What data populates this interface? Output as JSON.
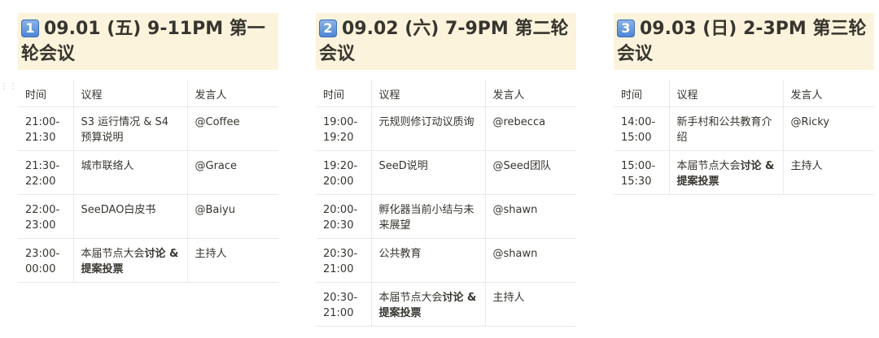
{
  "columns": [
    {
      "keycap": "1",
      "title": "09.01 (五) 9-11PM 第一轮会议",
      "headers": [
        "时间",
        "议程",
        "发言人"
      ],
      "rows": [
        {
          "time": "21:00-21:30",
          "agenda": "S3 运行情况 & S4 预算说明",
          "agenda_bold": "",
          "speaker": "@Coffee"
        },
        {
          "time": "21:30-22:00",
          "agenda": "城市联络人",
          "agenda_bold": "",
          "speaker": "@Grace"
        },
        {
          "time": "22:00-23:00",
          "agenda": "SeeDAO白皮书",
          "agenda_bold": "",
          "speaker": "@Baiyu"
        },
        {
          "time": "23:00-00:00",
          "agenda": "本届节点大会",
          "agenda_bold": "讨论 & 提案投票",
          "speaker": "主持人"
        }
      ]
    },
    {
      "keycap": "2",
      "title": "09.02 (六) 7-9PM 第二轮会议",
      "headers": [
        "时间",
        "议程",
        "发言人"
      ],
      "rows": [
        {
          "time": "19:00-19:20",
          "agenda": "元规则修订动议质询",
          "agenda_bold": "",
          "speaker": "@rebecca"
        },
        {
          "time": "19:20-20:00",
          "agenda": "SeeD说明",
          "agenda_bold": "",
          "speaker": "@Seed团队"
        },
        {
          "time": "20:00-20:30",
          "agenda": "孵化器当前小结与未来展望",
          "agenda_bold": "",
          "speaker": "@shawn"
        },
        {
          "time": "20:30-21:00",
          "agenda": "公共教育",
          "agenda_bold": "",
          "speaker": "@shawn"
        },
        {
          "time": "20:30-21:00",
          "agenda": "本届节点大会",
          "agenda_bold": "讨论 & 提案投票",
          "speaker": "主持人"
        }
      ]
    },
    {
      "keycap": "3",
      "title": "09.03 (日) 2-3PM 第三轮会议",
      "headers": [
        "时间",
        "议程",
        "发言人"
      ],
      "rows": [
        {
          "time": "14:00-15:00",
          "agenda": "新手村和公共教育介绍",
          "agenda_bold": "",
          "speaker": "@Ricky"
        },
        {
          "time": "15:00-15:30",
          "agenda": "本届节点大会",
          "agenda_bold": "讨论 & 提案投票",
          "speaker": "主持人"
        }
      ]
    }
  ]
}
